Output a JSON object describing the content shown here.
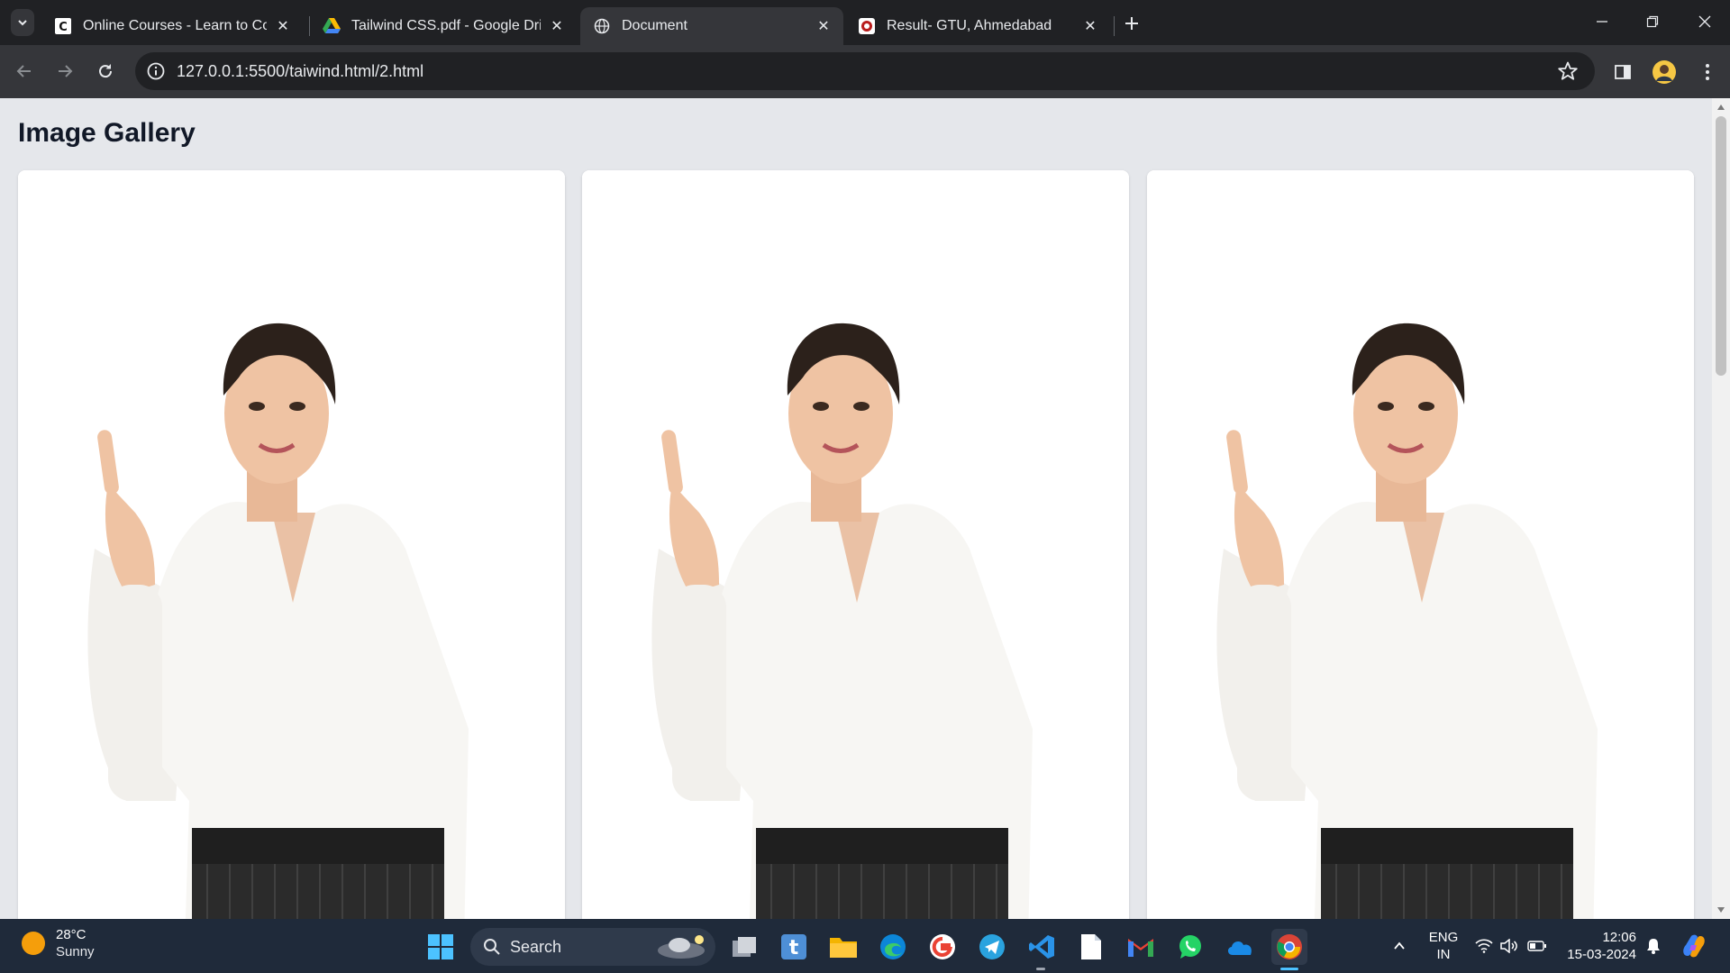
{
  "browser": {
    "tabs": [
      {
        "title": "Online Courses - Learn to Code",
        "favicon": "codecademy-icon",
        "active": false
      },
      {
        "title": "Tailwind CSS.pdf - Google Drive",
        "favicon": "google-drive-icon",
        "active": false
      },
      {
        "title": "Document",
        "favicon": "globe-icon",
        "active": true
      },
      {
        "title": "Result- GTU, Ahmedabad",
        "favicon": "gtu-icon",
        "active": false
      }
    ],
    "url": "127.0.0.1:5500/taiwind.html/2.html"
  },
  "page": {
    "title": "Image Gallery",
    "cards": [
      {
        "image": "woman-pointing-up-photo"
      },
      {
        "image": "woman-pointing-up-photo"
      },
      {
        "image": "woman-pointing-up-photo"
      }
    ]
  },
  "taskbar": {
    "weather": {
      "temp": "28°C",
      "condition": "Sunny"
    },
    "search_label": "Search",
    "apps": [
      "task-view-icon",
      "tumblr-icon",
      "file-explorer-icon",
      "edge-icon",
      "google-icon",
      "telegram-icon",
      "vscode-icon",
      "notepad-icon",
      "gmail-icon",
      "whatsapp-icon",
      "onedrive-icon",
      "chrome-icon"
    ],
    "language": {
      "line1": "ENG",
      "line2": "IN"
    },
    "clock": {
      "time": "12:06",
      "date": "15-03-2024"
    }
  },
  "colors": {
    "page_bg": "#e5e7eb",
    "card_bg": "#ffffff",
    "browser_dark": "#202124",
    "browser_toolbar": "#35363a",
    "taskbar": "#1f2a3a"
  }
}
